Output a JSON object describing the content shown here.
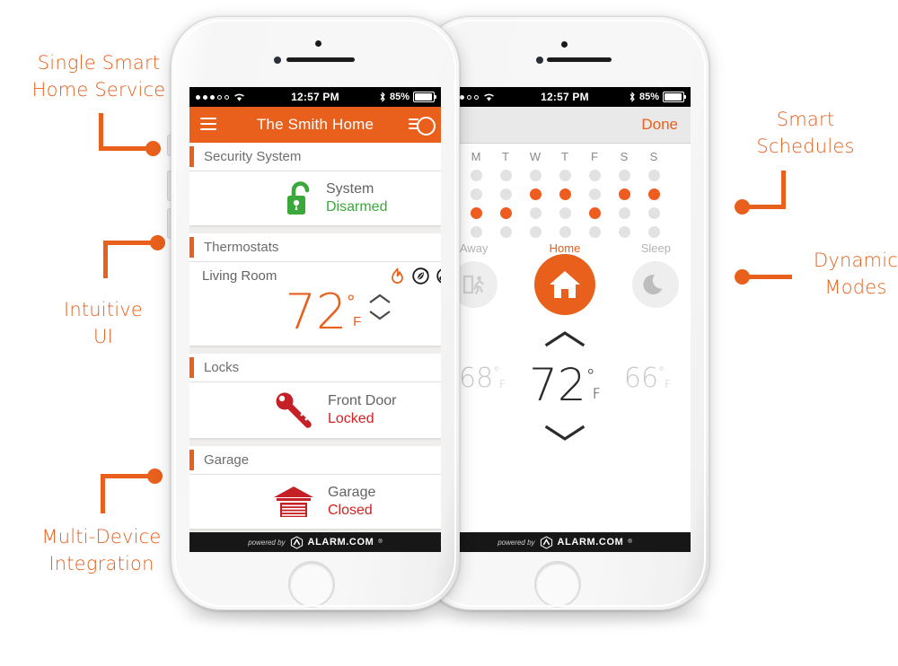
{
  "annotations": [
    {
      "id": "single-smart-home-service",
      "text": "Single Smart\nHome Service"
    },
    {
      "id": "intuitive-ui",
      "text": "Intuitive\nUI"
    },
    {
      "id": "multi-device-integration",
      "text": "Multi-Device\nIntegration"
    },
    {
      "id": "smart-schedules",
      "text": "Smart\nSchedules"
    },
    {
      "id": "dynamic-modes",
      "text": "Dynamic\nModes"
    }
  ],
  "colors": {
    "accent_orange": "#E8601C",
    "dot_orange": "#EF5C1F",
    "status_green": "#3AA93A",
    "status_red": "#D32121",
    "muted_gray": "#B4B4B4"
  },
  "status_bar": {
    "time": "12:57 PM",
    "battery_percent": "85%",
    "signal_dots_filled": 3,
    "signal_dots_total": 5,
    "wifi_icon": "wifi-icon",
    "bluetooth_icon": "bluetooth-icon",
    "battery_icon": "battery-icon"
  },
  "phone1": {
    "navbar": {
      "title": "The Smith Home",
      "menu_icon": "hamburger-menu-icon",
      "right_icon": "filter-settings-icon"
    },
    "sections": [
      {
        "id": "security-system",
        "header": "Security System",
        "rows": [
          {
            "icon": "unlocked-padlock-icon",
            "name": "System",
            "status": "Disarmed",
            "status_color": "green"
          }
        ]
      },
      {
        "id": "thermostats",
        "header": "Thermostats",
        "rows": [
          {
            "icon": "thermostat-icon",
            "name": "Living Room",
            "mode_icons": [
              "flame-heat-icon",
              "leaf-eco-icon",
              "fan-icon"
            ],
            "temperature": "72",
            "degree": "°",
            "unit": "F",
            "stepper_up_icon": "chevron-up-icon",
            "stepper_down_icon": "chevron-down-icon"
          }
        ]
      },
      {
        "id": "locks",
        "header": "Locks",
        "rows": [
          {
            "icon": "key-icon",
            "name": "Front Door",
            "status": "Locked",
            "status_color": "red"
          }
        ]
      },
      {
        "id": "garage",
        "header": "Garage",
        "rows": [
          {
            "icon": "garage-door-icon",
            "name": "Garage",
            "status": "Closed",
            "status_color": "red"
          }
        ]
      }
    ],
    "footer": {
      "powered_by": "powered by",
      "brand": "ALARM.COM",
      "registered": "®",
      "logo_icon": "alarm-com-hexagon-logo"
    }
  },
  "phone2": {
    "toolbar": {
      "done_label": "Done"
    },
    "schedule": {
      "day_headers": [
        "M",
        "T",
        "W",
        "T",
        "F",
        "S",
        "S"
      ],
      "rows": [
        [
          false,
          false,
          false,
          false,
          false,
          false,
          false
        ],
        [
          false,
          false,
          true,
          true,
          false,
          true,
          true
        ],
        [
          true,
          true,
          false,
          false,
          true,
          false,
          false
        ],
        [
          false,
          false,
          false,
          false,
          false,
          false,
          false
        ]
      ]
    },
    "modes": [
      {
        "id": "away",
        "label": "Away",
        "icon": "exit-running-person-icon",
        "active": false
      },
      {
        "id": "home",
        "label": "Home",
        "icon": "house-icon",
        "active": true
      },
      {
        "id": "sleep",
        "label": "Sleep",
        "icon": "moon-icon",
        "active": false
      }
    ],
    "temperature": {
      "up_icon": "chevron-up-icon",
      "down_icon": "chevron-down-icon",
      "left": {
        "value": "68",
        "degree": "°",
        "unit": "F"
      },
      "main": {
        "value": "72",
        "degree": "°",
        "unit": "F"
      },
      "right": {
        "value": "66",
        "degree": "°",
        "unit": "F"
      }
    },
    "footer": {
      "powered_by": "powered by",
      "brand": "ALARM.COM",
      "registered": "®",
      "logo_icon": "alarm-com-hexagon-logo"
    }
  }
}
